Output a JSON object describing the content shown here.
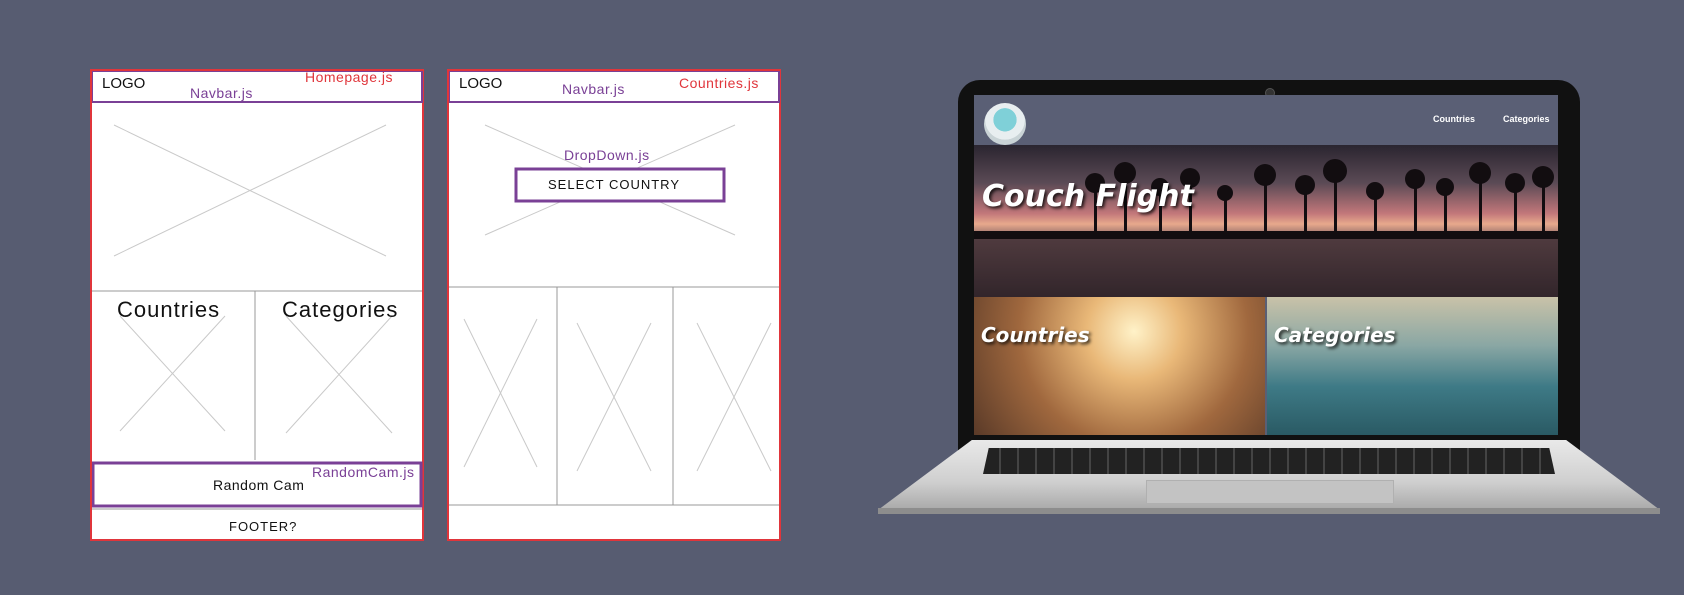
{
  "colors": {
    "background": "#575c71",
    "wire_red": "#e0353b",
    "wire_purple": "#7a4096"
  },
  "homepage": {
    "logo": "LOGO",
    "navbar_label": "Navbar.js",
    "file_label": "Homepage.js",
    "countries": "Countries",
    "categories": "Categories",
    "random_cam_label": "RandomCam.js",
    "random_cam": "Random Cam",
    "footer": "FOOTER?"
  },
  "countries_page": {
    "logo": "LOGO",
    "navbar_label": "Navbar.js",
    "file_label": "Countries.js",
    "dropdown_label": "DropDown.js",
    "select_country": "SELECT COUNTRY"
  },
  "laptop": {
    "nav": [
      "Countries",
      "Categories"
    ],
    "hero_title": "Couch Flight",
    "tile_countries": "Countries",
    "tile_categories": "Categories",
    "logo_icon": "globe-robot-logo-icon"
  }
}
